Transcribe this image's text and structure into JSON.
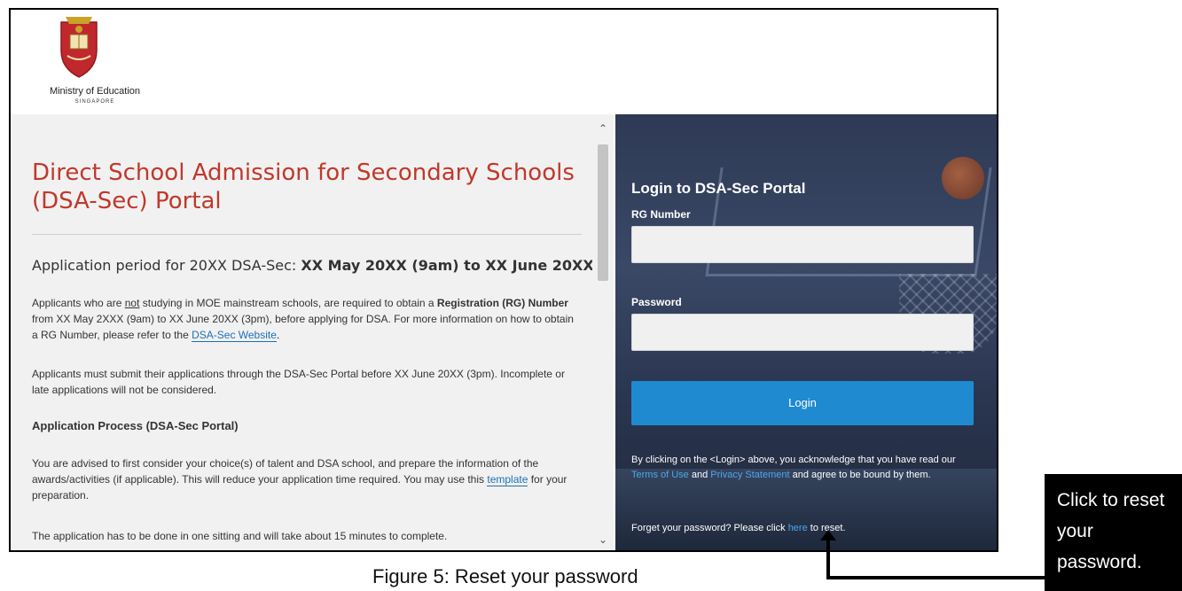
{
  "header": {
    "ministry_name": "Ministry of Education",
    "country": "SINGAPORE"
  },
  "left": {
    "title": "Direct School Admission for Secondary Schools (DSA-Sec) Portal",
    "period_prefix": "Application period for 20XX DSA-Sec: ",
    "period_dates": "XX May 20XX (9am) to XX June 20XX (3pm)",
    "p1_a": "Applicants who are ",
    "p1_not": "not",
    "p1_b": " studying in MOE mainstream schools, are required to obtain a ",
    "p1_rg": "Registration (RG) Number",
    "p1_c": " from XX May 2XXX (9am) to XX June 20XX (3pm), before applying for DSA. For more information on how to obtain a RG Number, please refer to the ",
    "p1_link": "DSA-Sec Website",
    "p1_end": ".",
    "p2": "Applicants must submit their applications through the DSA-Sec Portal before XX June 20XX (3pm). Incomplete or late applications will not be considered.",
    "process_heading": "Application Process (DSA-Sec Portal)",
    "p3_a": "You are advised to first consider your choice(s) of talent and DSA school, and prepare the information of the awards/activities (if applicable). This will reduce your application time required. You may use this ",
    "p3_link": "template",
    "p3_b": " for your preparation.",
    "p4": "The application has to be done in one sitting and will take about 15 minutes to complete."
  },
  "login": {
    "title": "Login to DSA-Sec Portal",
    "rg_label": "RG Number",
    "password_label": "Password",
    "button": "Login",
    "ack_a": "By clicking on the <Login> above, you acknowledge that you have read our ",
    "terms_link": "Terms of Use",
    "ack_and": " and ",
    "privacy_link": "Privacy Statement",
    "ack_b": " and agree to be bound by them.",
    "forgot_a": "Forget your password? Please click ",
    "forgot_link": "here",
    "forgot_b": " to reset."
  },
  "annotation": {
    "caption": "Figure 5:  Reset your password",
    "callout": "Click to reset your password."
  },
  "colors": {
    "title_red": "#c0392b",
    "button_blue": "#1f8ad0",
    "link_blue": "#1e6fb8"
  },
  "icons": [
    "moe-crest-logo",
    "scroll-up-icon",
    "scroll-down-icon"
  ]
}
